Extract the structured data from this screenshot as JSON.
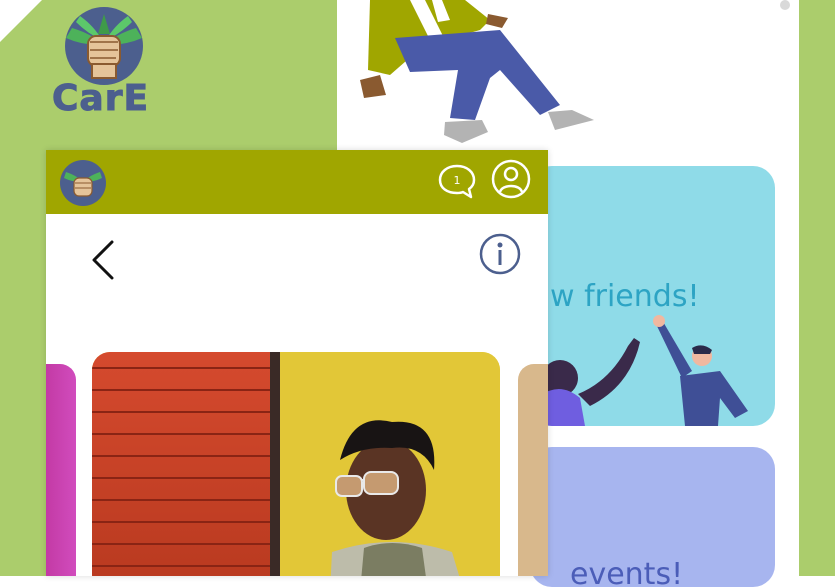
{
  "app": {
    "logo_text": "CarE"
  },
  "cards": {
    "blue_text": "w friends!",
    "purple_text": "events!"
  },
  "phone": {
    "message_count": "1"
  },
  "colors": {
    "background_green": "#abcd6c",
    "header_olive": "#a0a600",
    "card_blue": "#8fdbe8",
    "card_purple": "#a7b5ef",
    "accent_navy": "#4c5f8e"
  },
  "icons": [
    "care-logo-icon",
    "message-icon",
    "user-icon",
    "back-icon",
    "info-icon"
  ]
}
